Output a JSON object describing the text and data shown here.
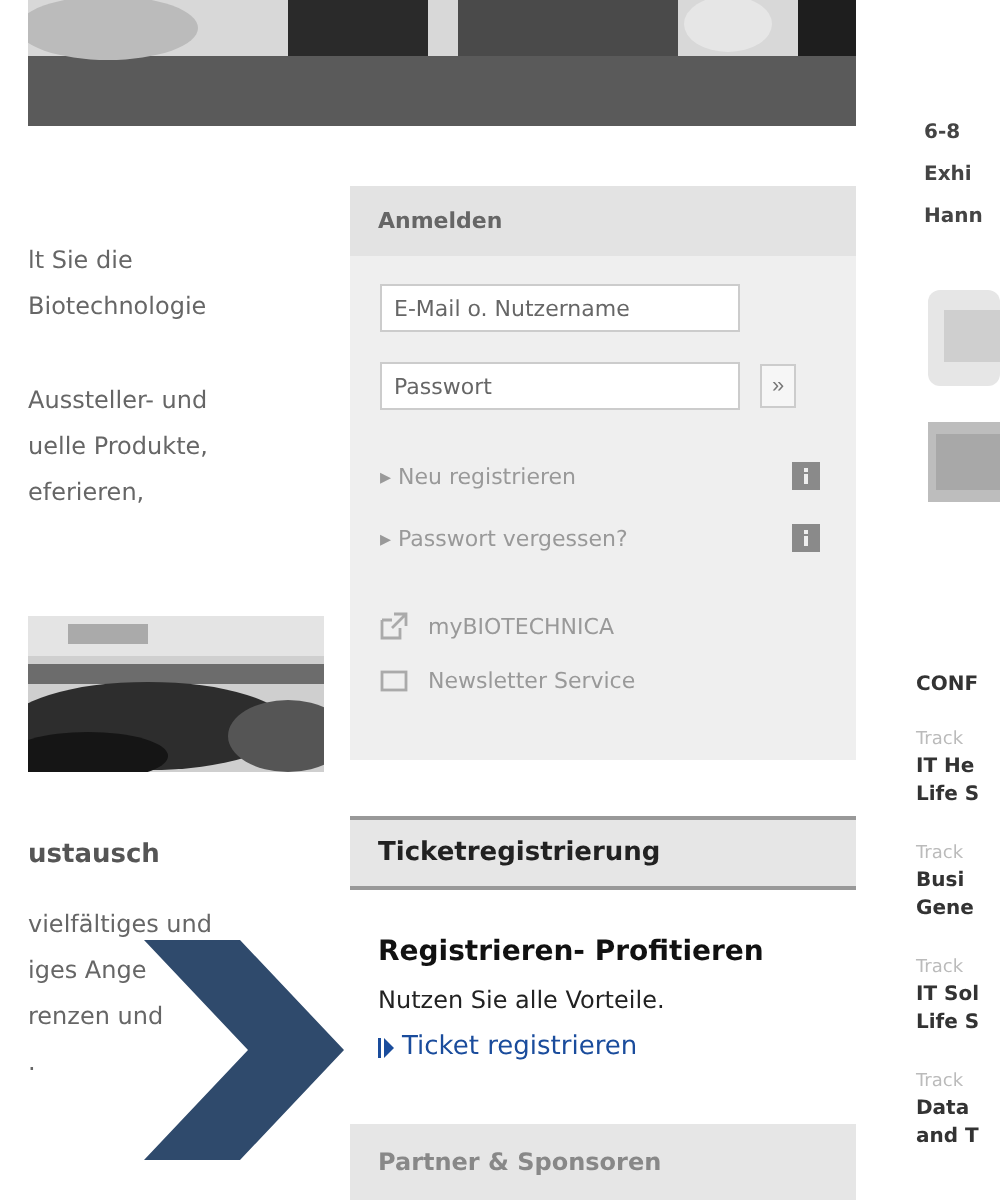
{
  "left_column": {
    "intro_lines": [
      "lt Sie die",
      "Biotechnologie"
    ],
    "second_lines": [
      "Aussteller- und",
      "uelle Produkte,",
      "eferieren,"
    ],
    "photo": {
      "kind": "picture"
    },
    "heading": "ustausch",
    "text_lines": [
      "vielfältiges und",
      "iges Ange",
      "renzen und",
      "."
    ]
  },
  "login": {
    "title": "Anmelden",
    "username_placeholder": "E-Mail o. Nutzername",
    "password_placeholder": "Passwort",
    "submit_label": "»",
    "links": [
      "▸ Neu registrieren",
      "▸ Passwort vergessen?"
    ],
    "services": [
      {
        "kind": "external",
        "label": "myBIOTECHNICA"
      },
      {
        "kind": "mail",
        "label": "Newsletter Service"
      }
    ]
  },
  "ticket": {
    "title": "Ticketregistrierung",
    "headline": "Registrieren- Profitieren",
    "text": "Nutzen Sie alle Vorteile.",
    "link": "Ticket registrieren"
  },
  "partner": {
    "title": "Partner & Sponsoren"
  },
  "right_column": {
    "date_lines": [
      "6-8",
      "Exhi",
      "Hann"
    ],
    "heading": "CONF",
    "tracks": [
      {
        "label": "Track",
        "lines": [
          "IT He",
          "Life S"
        ]
      },
      {
        "label": "Track",
        "lines": [
          "Busi",
          "Gene"
        ]
      },
      {
        "label": "Track",
        "lines": [
          "IT Sol",
          "Life S"
        ]
      },
      {
        "label": "Track",
        "lines": [
          "Data",
          "and T"
        ]
      }
    ]
  }
}
